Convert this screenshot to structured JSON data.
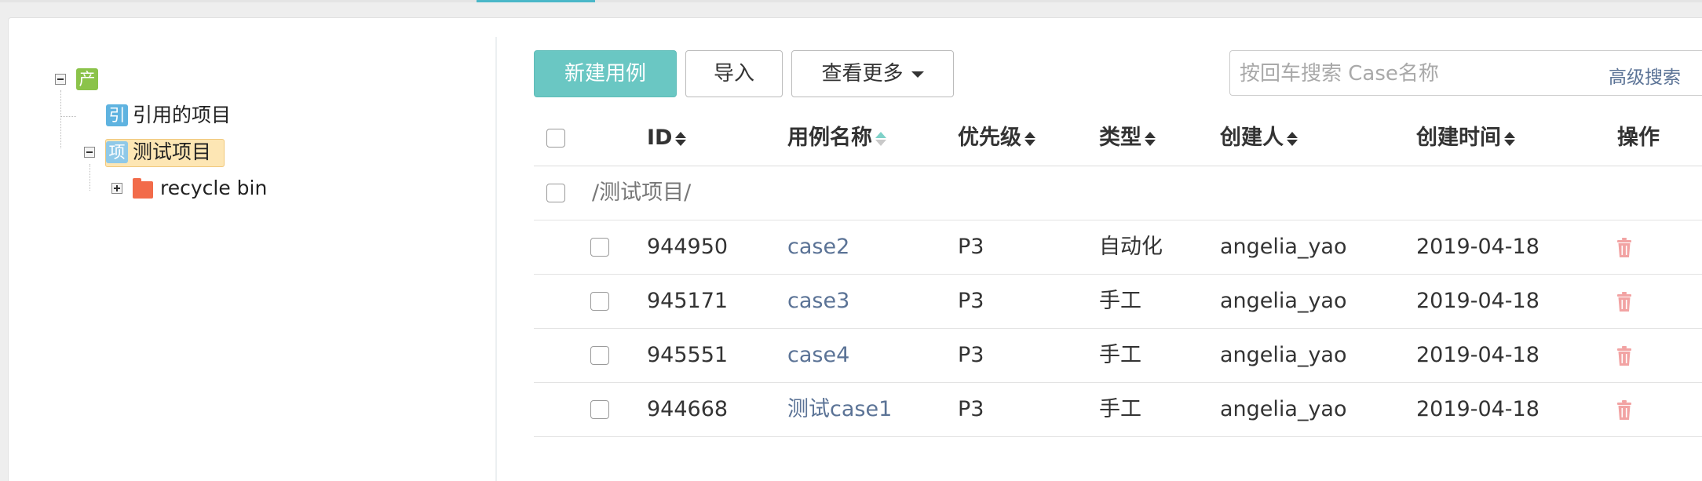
{
  "tree": {
    "root": {
      "badge": "产"
    },
    "nodes": [
      {
        "badge": "引",
        "label": "引用的项目"
      },
      {
        "badge": "项",
        "label": "测试项目"
      },
      {
        "label": "recycle bin"
      }
    ]
  },
  "toolbar": {
    "new_case_label": "新建用例",
    "import_label": "导入",
    "more_label": "查看更多"
  },
  "search": {
    "placeholder": "按回车搜索 Case名称",
    "value": "",
    "advanced_label": "高级搜索"
  },
  "table": {
    "columns": {
      "id": "ID",
      "name": "用例名称",
      "priority": "优先级",
      "type": "类型",
      "creator": "创建人",
      "created_at": "创建时间",
      "actions": "操作"
    },
    "group_path": "/测试项目/",
    "rows": [
      {
        "id": "944950",
        "name": "case2",
        "priority": "P3",
        "type": "自动化",
        "creator": "angelia_yao",
        "created_at": "2019-04-18"
      },
      {
        "id": "945171",
        "name": "case3",
        "priority": "P3",
        "type": "手工",
        "creator": "angelia_yao",
        "created_at": "2019-04-18"
      },
      {
        "id": "945551",
        "name": "case4",
        "priority": "P3",
        "type": "手工",
        "creator": "angelia_yao",
        "created_at": "2019-04-18"
      },
      {
        "id": "944668",
        "name": "测试case1",
        "priority": "P3",
        "type": "手工",
        "creator": "angelia_yao",
        "created_at": "2019-04-18"
      }
    ]
  },
  "colors": {
    "primary": "#6ac7c3",
    "link": "#5b7396",
    "delete_icon": "#f2a3a3",
    "selected_node_bg": "#fde6b4"
  },
  "icons": {
    "sort": "sort-caret-icon",
    "delete": "trash-icon",
    "folder": "folder-icon"
  }
}
